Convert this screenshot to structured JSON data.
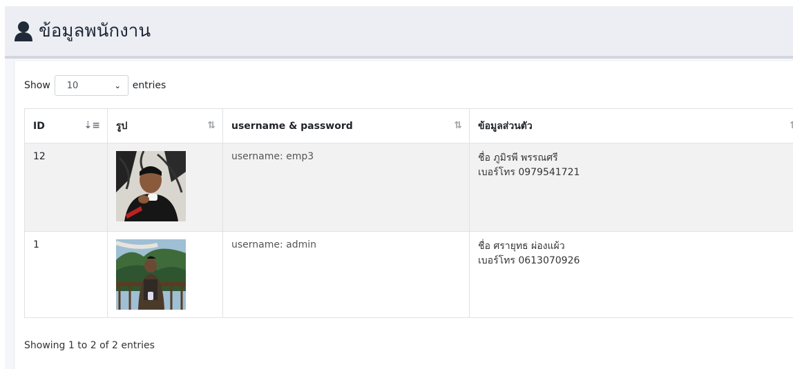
{
  "header": {
    "title": "ข้อมูลพนักงาน",
    "icon": "user-icon"
  },
  "length": {
    "show_label": "Show",
    "selected": "10",
    "entries_label": "entries"
  },
  "table": {
    "columns": [
      "ID",
      "รูป",
      "username & password",
      "ข้อมูลส่วนตัว"
    ],
    "rows": [
      {
        "id": "12",
        "photo": "employee-photo",
        "username": "username: emp3",
        "name": "ชื่อ ภูมิรพี พรรณศรี",
        "phone": "เบอร์โทร 0979541721"
      },
      {
        "id": "1",
        "photo": "employee-photo",
        "username": "username: admin",
        "name": "ชื่อ ศรายุทธ ผ่องแผ้ว",
        "phone": "เบอร์โทร 0613070926"
      }
    ]
  },
  "info": "Showing 1 to 2 of 2 entries"
}
